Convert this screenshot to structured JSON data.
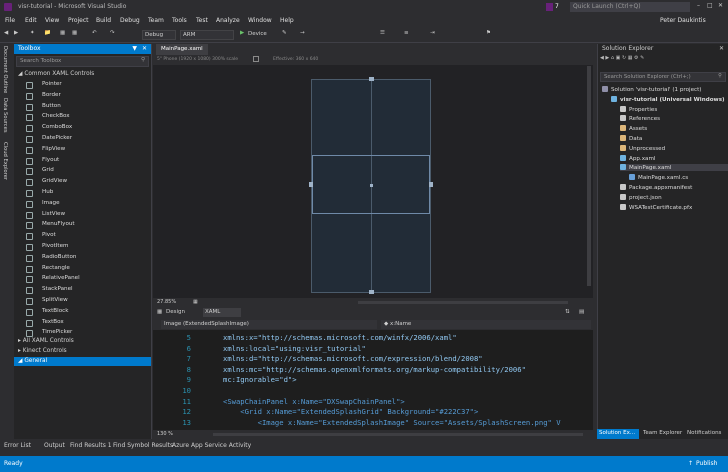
{
  "window": {
    "title": "visr-tutorial - Microsoft Visual Studio",
    "quick_launch": "Quick Launch (Ctrl+Q)",
    "user": "Peter Daukintis",
    "notification_count": "7"
  },
  "menu": [
    "File",
    "Edit",
    "View",
    "Project",
    "Build",
    "Debug",
    "Team",
    "Tools",
    "Test",
    "Analyze",
    "Window",
    "Help"
  ],
  "toolbar": {
    "config": "Debug",
    "platform": "ARM",
    "run_target": "Device"
  },
  "side_tabs": [
    "Document Outline",
    "Data Sources",
    "Cloud Explorer"
  ],
  "toolbox": {
    "title": "Toolbox",
    "search_placeholder": "Search Toolbox",
    "group": "Common XAML Controls",
    "items": [
      "Pointer",
      "Border",
      "Button",
      "CheckBox",
      "ComboBox",
      "DatePicker",
      "FlipView",
      "Flyout",
      "Grid",
      "GridView",
      "Hub",
      "Image",
      "ListView",
      "MenuFlyout",
      "Pivot",
      "PivotItem",
      "RadioButton",
      "Rectangle",
      "RelativePanel",
      "StackPanel",
      "SplitView",
      "TextBlock",
      "TextBox",
      "TimePicker"
    ],
    "other_groups": [
      "All XAML Controls",
      "Kinect Controls",
      "General"
    ]
  },
  "designer": {
    "tab": "MainPage.xaml",
    "device_label": "5\" Phone (1920 x 1080) 300% scale",
    "effective": "Effective: 360 x 640",
    "zoom": "27.85%",
    "design_tab": "Design",
    "xaml_tab": "XAML",
    "element_selector": "Image (ExtendedSplashImage)",
    "name_selector": "x:Name"
  },
  "editor": {
    "zoom": "130 %",
    "lines": [
      {
        "n": "5",
        "code": "xmlns:x=\"http://schemas.microsoft.com/winfx/2006/xaml\""
      },
      {
        "n": "6",
        "code": "xmlns:local=\"using:visr_tutorial\""
      },
      {
        "n": "7",
        "code": "xmlns:d=\"http://schemas.microsoft.com/expression/blend/2008\""
      },
      {
        "n": "8",
        "code": "xmlns:mc=\"http://schemas.openxmlformats.org/markup-compatibility/2006\""
      },
      {
        "n": "9",
        "code": "mc:Ignorable=\"d\">"
      },
      {
        "n": "10",
        "code": ""
      },
      {
        "n": "11",
        "code": "<SwapChainPanel x:Name=\"DXSwapChainPanel\">"
      },
      {
        "n": "12",
        "code": "    <Grid x:Name=\"ExtendedSplashGrid\" Background=\"#222C37\">"
      },
      {
        "n": "13",
        "code": "        <Image x:Name=\"ExtendedSplashImage\" Source=\"Assets/SplashScreen.png\" V"
      }
    ]
  },
  "solution_explorer": {
    "title": "Solution Explorer",
    "search_placeholder": "Search Solution Explorer (Ctrl+;)",
    "items": [
      {
        "label": "Solution 'visr-tutorial' (1 project)",
        "depth": 0,
        "icon": "#8f8fa8"
      },
      {
        "label": "visr-tutorial (Universal Windows)",
        "depth": 1,
        "icon": "#6fb3e0",
        "bold": true
      },
      {
        "label": "Properties",
        "depth": 2,
        "icon": "#c8c8c8"
      },
      {
        "label": "References",
        "depth": 2,
        "icon": "#c8c8c8"
      },
      {
        "label": "Assets",
        "depth": 2,
        "icon": "#dcb67a"
      },
      {
        "label": "Data",
        "depth": 2,
        "icon": "#dcb67a"
      },
      {
        "label": "Unprocessed",
        "depth": 2,
        "icon": "#dcb67a"
      },
      {
        "label": "App.xaml",
        "depth": 2,
        "icon": "#6fb3e0"
      },
      {
        "label": "MainPage.xaml",
        "depth": 2,
        "icon": "#6fb3e0",
        "selected": true
      },
      {
        "label": "MainPage.xaml.cs",
        "depth": 3,
        "icon": "#68a0d8"
      },
      {
        "label": "Package.appxmanifest",
        "depth": 2,
        "icon": "#c8c8c8"
      },
      {
        "label": "project.json",
        "depth": 2,
        "icon": "#c8c8c8"
      },
      {
        "label": "WSATestCertificate.pfx",
        "depth": 2,
        "icon": "#c8c8c8"
      }
    ],
    "bottom_tabs": [
      "Solution Ex...",
      "Team Explorer",
      "Notifications"
    ]
  },
  "bottom_tabs": [
    "Error List",
    "Output",
    "Find Results 1",
    "Find Symbol Results",
    "Azure App Service Activity"
  ],
  "status": {
    "left": "Ready",
    "right": "Publish"
  },
  "colors": {
    "accent": "#007acc",
    "background": "#2d2d30",
    "device": "#222c37"
  }
}
